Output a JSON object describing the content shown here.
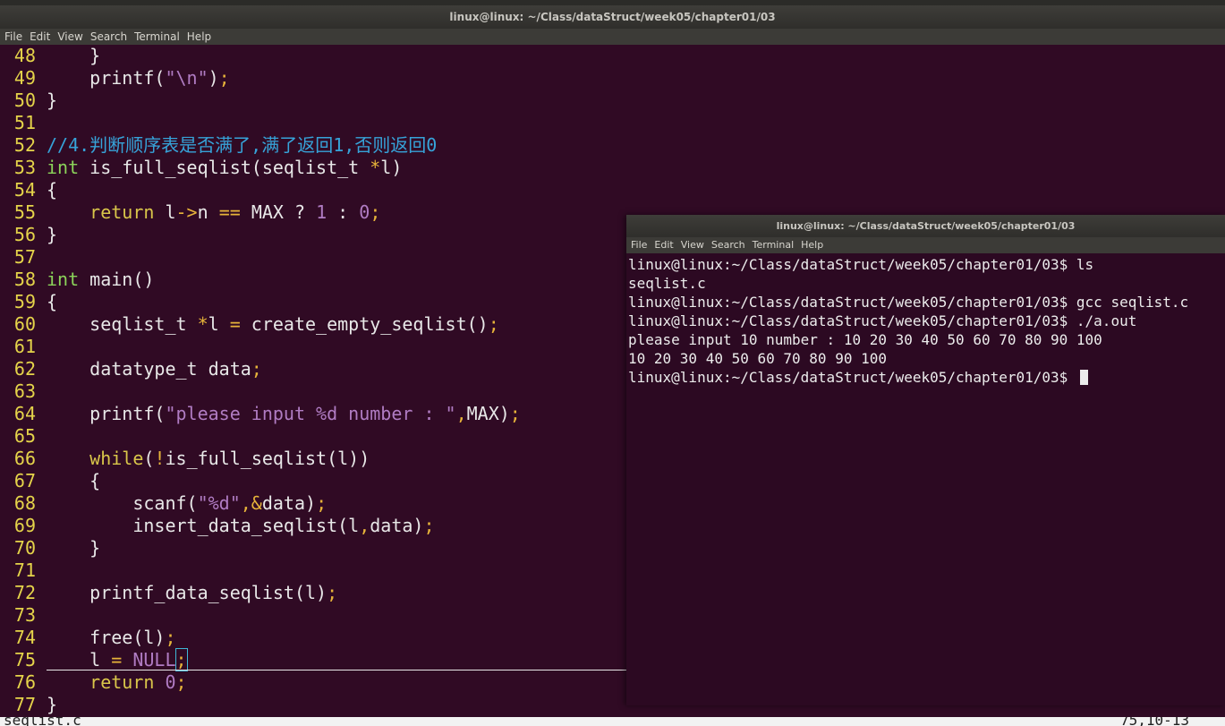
{
  "window": {
    "title": "linux@linux: ~/Class/dataStruct/week05/chapter01/03"
  },
  "menu": [
    "File",
    "Edit",
    "View",
    "Search",
    "Terminal",
    "Help"
  ],
  "editor": {
    "lines": [
      {
        "n": "48",
        "t": "    }"
      },
      {
        "n": "49",
        "t": "    printf(\"\\n\");"
      },
      {
        "n": "50",
        "t": "}"
      },
      {
        "n": "51",
        "t": ""
      },
      {
        "n": "52",
        "t": "//4.判断顺序表是否满了,满了返回1,否则返回0"
      },
      {
        "n": "53",
        "t": "int is_full_seqlist(seqlist_t *l)"
      },
      {
        "n": "54",
        "t": "{"
      },
      {
        "n": "55",
        "t": "    return l->n == MAX ? 1 : 0;"
      },
      {
        "n": "56",
        "t": "}"
      },
      {
        "n": "57",
        "t": ""
      },
      {
        "n": "58",
        "t": "int main()"
      },
      {
        "n": "59",
        "t": "{"
      },
      {
        "n": "60",
        "t": "    seqlist_t *l = create_empty_seqlist();"
      },
      {
        "n": "61",
        "t": ""
      },
      {
        "n": "62",
        "t": "    datatype_t data;"
      },
      {
        "n": "63",
        "t": ""
      },
      {
        "n": "64",
        "t": "    printf(\"please input %d number : \",MAX);"
      },
      {
        "n": "65",
        "t": ""
      },
      {
        "n": "66",
        "t": "    while(!is_full_seqlist(l))"
      },
      {
        "n": "67",
        "t": "    {"
      },
      {
        "n": "68",
        "t": "        scanf(\"%d\",&data);"
      },
      {
        "n": "69",
        "t": "        insert_data_seqlist(l,data);"
      },
      {
        "n": "70",
        "t": "    }"
      },
      {
        "n": "71",
        "t": ""
      },
      {
        "n": "72",
        "t": "    printf_data_seqlist(l);"
      },
      {
        "n": "73",
        "t": ""
      },
      {
        "n": "74",
        "t": "    free(l);"
      },
      {
        "n": "75",
        "t": "    l = NULL;"
      },
      {
        "n": "76",
        "t": "    return 0;"
      },
      {
        "n": "77",
        "t": "}"
      }
    ]
  },
  "statusbar": {
    "file": "seqlist.c",
    "position": "75,10-13"
  },
  "terminal": {
    "title": "linux@linux: ~/Class/dataStruct/week05/chapter01/03",
    "lines": [
      "linux@linux:~/Class/dataStruct/week05/chapter01/03$ ls",
      "seqlist.c",
      "linux@linux:~/Class/dataStruct/week05/chapter01/03$ gcc seqlist.c",
      "linux@linux:~/Class/dataStruct/week05/chapter01/03$ ./a.out",
      "please input 10 number : 10 20 30 40 50 60 70 80 90 100",
      "10 20 30 40 50 60 70 80 90 100",
      "linux@linux:~/Class/dataStruct/week05/chapter01/03$ "
    ]
  },
  "colors": {
    "background": "#300a24",
    "line_number": "#e5d44a",
    "comment": "#36a3d9",
    "type": "#8bd35a",
    "keyword": "#d9c64a",
    "string": "#b07cc3"
  }
}
